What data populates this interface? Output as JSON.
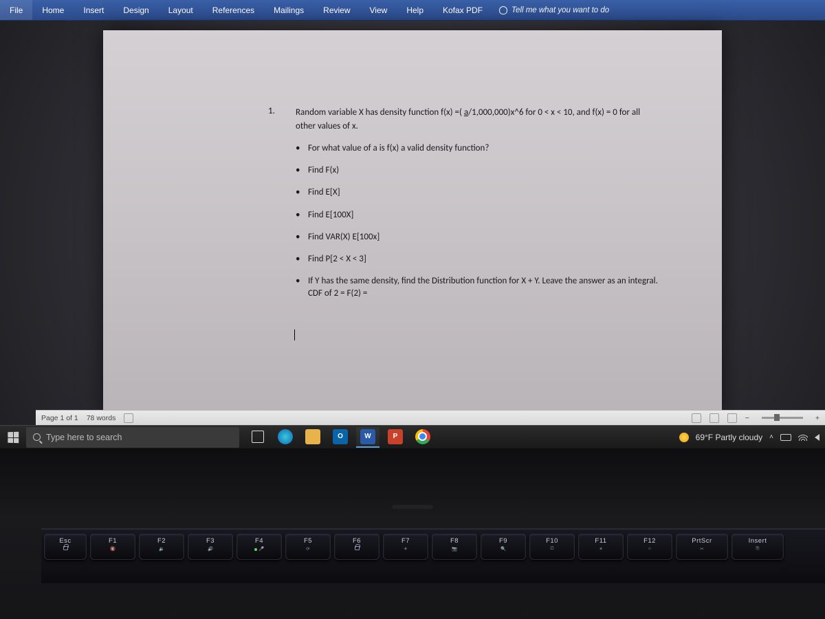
{
  "ribbon": {
    "tabs": [
      "File",
      "Home",
      "Insert",
      "Design",
      "Layout",
      "References",
      "Mailings",
      "Review",
      "View",
      "Help",
      "Kofax PDF"
    ],
    "tellme": "Tell me what you want to do"
  },
  "document": {
    "qnum": "1.",
    "q_line1_a": "Random variable X has density function f(x) =( ",
    "q_line1_u": "a",
    "q_line1_b": "/1,000,000)x^6 for 0 < x < 10, and f(x) = 0 for all",
    "q_line2": "other values of x.",
    "bullets": [
      "For what value of a is f(x) a valid density function?",
      "Find F(x)",
      "Find E[X]",
      "Find E[100X]",
      "Find VAR(X) E[100x]",
      "Find P[2 < X < 3]",
      "If Y has the same density, find the Distribution function for X + Y.  Leave the answer as an integral. CDF of 2 = F(2) ="
    ]
  },
  "status": {
    "page": "Page 1 of 1",
    "words": "78 words"
  },
  "taskbar": {
    "search_placeholder": "Type here to search",
    "weather": "69°F Partly cloudy"
  },
  "keys": {
    "esc": "Esc",
    "f1": "F1",
    "f2": "F2",
    "f3": "F3",
    "f4": "F4",
    "f5": "F5",
    "f6": "F6",
    "f7": "F7",
    "f8": "F8",
    "f9": "F9",
    "f10": "F10",
    "f11": "F11",
    "f12": "F12",
    "prtscr": "PrtScr",
    "insert": "Insert"
  }
}
